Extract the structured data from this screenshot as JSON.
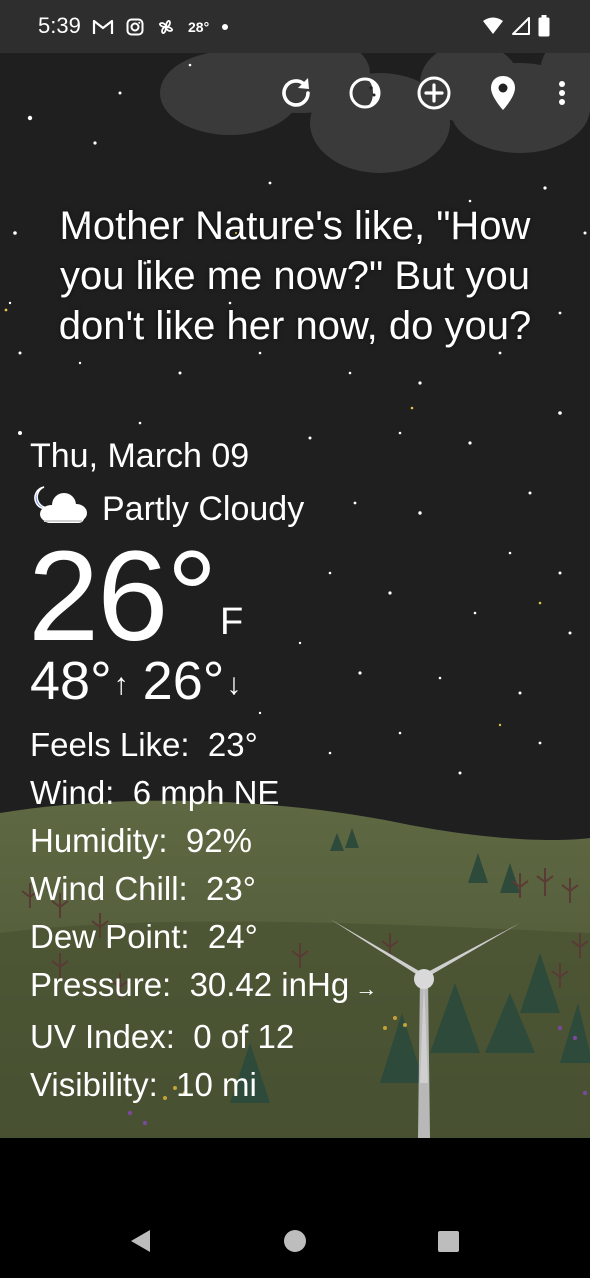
{
  "status_bar": {
    "time": "5:39",
    "temp": "28°",
    "icons": [
      "gmail-icon",
      "instagram-icon",
      "pinwheel-icon",
      "dot-icon",
      "wifi-icon",
      "signal-icon",
      "battery-icon"
    ]
  },
  "toolbar": {
    "icons": [
      "refresh-icon",
      "moon-phase-icon",
      "add-location-icon",
      "location-pin-icon",
      "more-options-icon"
    ]
  },
  "quote": "Mother Nature's like, \"How you like me now?\" But you don't like her now, do you?",
  "weather": {
    "date": "Thu, March 09",
    "condition": "Partly Cloudy",
    "condition_icon": "partly-cloudy-night-icon",
    "temperature": "26°",
    "unit": "F",
    "high": "48°",
    "low": "26°",
    "details": [
      {
        "label": "Feels Like:",
        "value": "23°"
      },
      {
        "label": "Wind:",
        "value": "6 mph NE"
      },
      {
        "label": "Humidity:",
        "value": "92%"
      },
      {
        "label": "Wind Chill:",
        "value": "23°"
      },
      {
        "label": "Dew Point:",
        "value": "24°"
      },
      {
        "label": "Pressure:",
        "value": "30.42 inHg",
        "trend": "→"
      },
      {
        "label": "UV Index:",
        "value": "0 of 12"
      },
      {
        "label": "Visibility:",
        "value": "10 mi"
      }
    ]
  },
  "nav": {
    "buttons": [
      "back-icon",
      "home-icon",
      "recents-icon"
    ]
  },
  "colors": {
    "status_bg": "#2e2e2e",
    "sky": "#1f1f1f",
    "hill": "#4f5a37",
    "nav_bg": "#000000"
  }
}
